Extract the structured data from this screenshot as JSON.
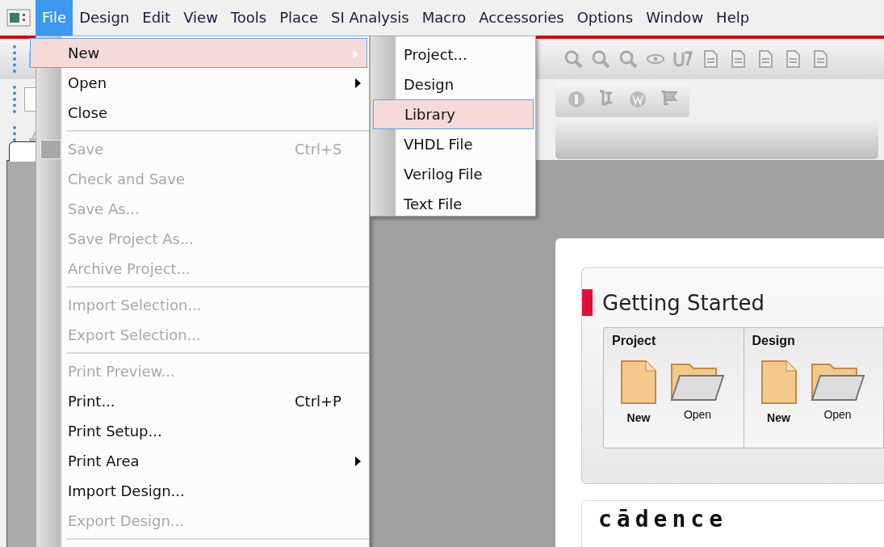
{
  "menubar": [
    {
      "label": "File",
      "selected": true
    },
    {
      "label": "Design",
      "selected": false
    },
    {
      "label": "Edit",
      "selected": false
    },
    {
      "label": "View",
      "selected": false
    },
    {
      "label": "Tools",
      "selected": false
    },
    {
      "label": "Place",
      "selected": false
    },
    {
      "label": "SI Analysis",
      "selected": false
    },
    {
      "label": "Macro",
      "selected": false
    },
    {
      "label": "Accessories",
      "selected": false
    },
    {
      "label": "Options",
      "selected": false
    },
    {
      "label": "Window",
      "selected": false
    },
    {
      "label": "Help",
      "selected": false
    }
  ],
  "file_menu": [
    {
      "kind": "item",
      "label": "New",
      "submenu": true,
      "disabled": false,
      "selected": true
    },
    {
      "kind": "item",
      "label": "Open",
      "submenu": true,
      "disabled": false,
      "selected": false
    },
    {
      "kind": "item",
      "label": "Close",
      "disabled": false,
      "selected": false
    },
    {
      "kind": "separator"
    },
    {
      "kind": "icon_item",
      "label": "Save",
      "shortcut": "Ctrl+S",
      "disabled": true,
      "selected": false
    },
    {
      "kind": "item",
      "label": "Check and Save",
      "disabled": true,
      "selected": false
    },
    {
      "kind": "item",
      "label": "Save As...",
      "disabled": true,
      "selected": false
    },
    {
      "kind": "item",
      "label": "Save Project As...",
      "disabled": true,
      "selected": false
    },
    {
      "kind": "item",
      "label": "Archive Project...",
      "disabled": true,
      "selected": false
    },
    {
      "kind": "separator"
    },
    {
      "kind": "item",
      "label": "Import Selection...",
      "disabled": true,
      "selected": false
    },
    {
      "kind": "item",
      "label": "Export Selection...",
      "disabled": true,
      "selected": false
    },
    {
      "kind": "separator"
    },
    {
      "kind": "item",
      "label": "Print Preview...",
      "disabled": true,
      "selected": false
    },
    {
      "kind": "item",
      "label": "Print...",
      "shortcut": "Ctrl+P",
      "disabled": false,
      "selected": false
    },
    {
      "kind": "item",
      "label": "Print Setup...",
      "disabled": false,
      "selected": false
    },
    {
      "kind": "item",
      "label": "Print Area",
      "submenu": true,
      "disabled": false,
      "selected": false
    },
    {
      "kind": "item",
      "label": "Import Design...",
      "disabled": false,
      "selected": false
    },
    {
      "kind": "item",
      "label": "Export Design...",
      "disabled": true,
      "selected": false
    },
    {
      "kind": "separator"
    }
  ],
  "new_submenu": [
    {
      "label": "Project...",
      "selected": false
    },
    {
      "label": "Design",
      "selected": false
    },
    {
      "label": "Library",
      "selected": true
    },
    {
      "label": "VHDL File",
      "selected": false
    },
    {
      "label": "Verilog File",
      "selected": false
    },
    {
      "label": "Text File",
      "selected": false
    }
  ],
  "start_page": {
    "title": "Getting Started",
    "groups": [
      {
        "title": "Project",
        "actions": [
          {
            "kind": "new",
            "label": "New"
          },
          {
            "kind": "open",
            "label": "Open"
          }
        ]
      },
      {
        "title": "Design",
        "actions": [
          {
            "kind": "new",
            "label": "New"
          },
          {
            "kind": "open",
            "label": "Open"
          }
        ]
      }
    ],
    "logo": "cādence"
  }
}
